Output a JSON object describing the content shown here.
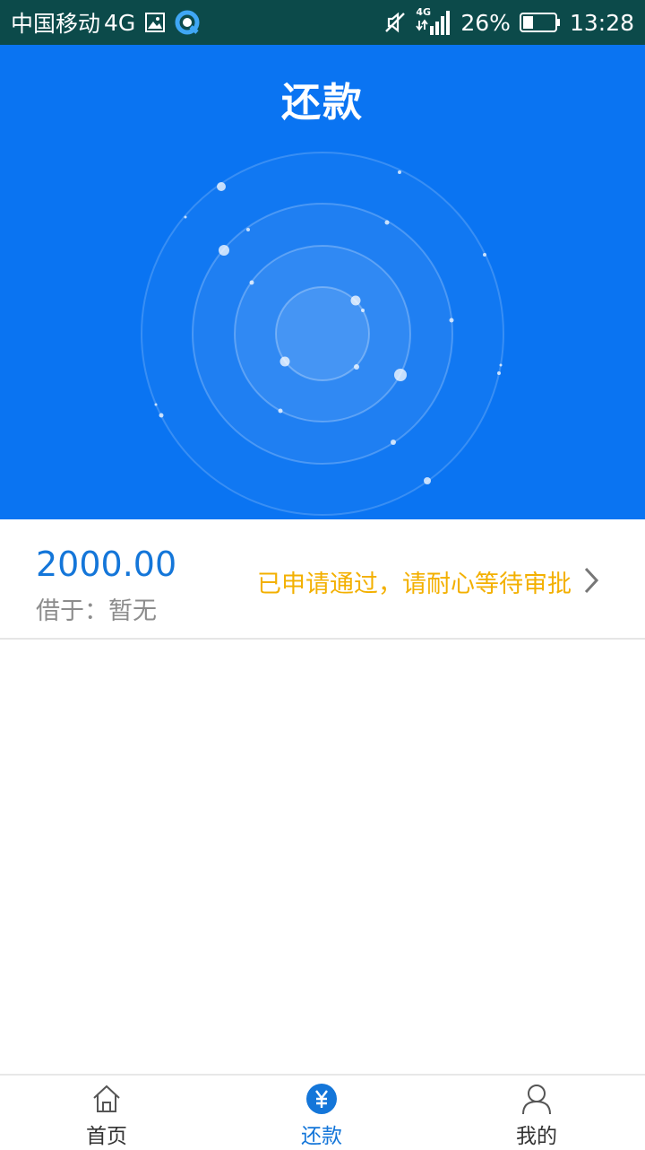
{
  "status_bar": {
    "carrier": "中国移动",
    "network": "4G",
    "signal_network": "4G",
    "battery": "26%",
    "time": "13:28",
    "icons": [
      "gallery-icon",
      "assistant-app-icon",
      "mute-icon",
      "signal-icon",
      "battery-icon"
    ]
  },
  "header": {
    "title": "还款",
    "background_color": "#0a74f2"
  },
  "loan": {
    "amount": "2000.00",
    "borrowed_from": "借于：暂无",
    "status": "已申请通过，请耐心等待审批",
    "status_color": "#f3b000",
    "amount_color": "#1476d9"
  },
  "tabbar": {
    "tabs": [
      {
        "label": "首页",
        "icon": "home-icon",
        "active": false
      },
      {
        "label": "还款",
        "icon": "yen-icon",
        "active": true
      },
      {
        "label": "我的",
        "icon": "user-icon",
        "active": false
      }
    ],
    "active_color": "#1476d9"
  }
}
